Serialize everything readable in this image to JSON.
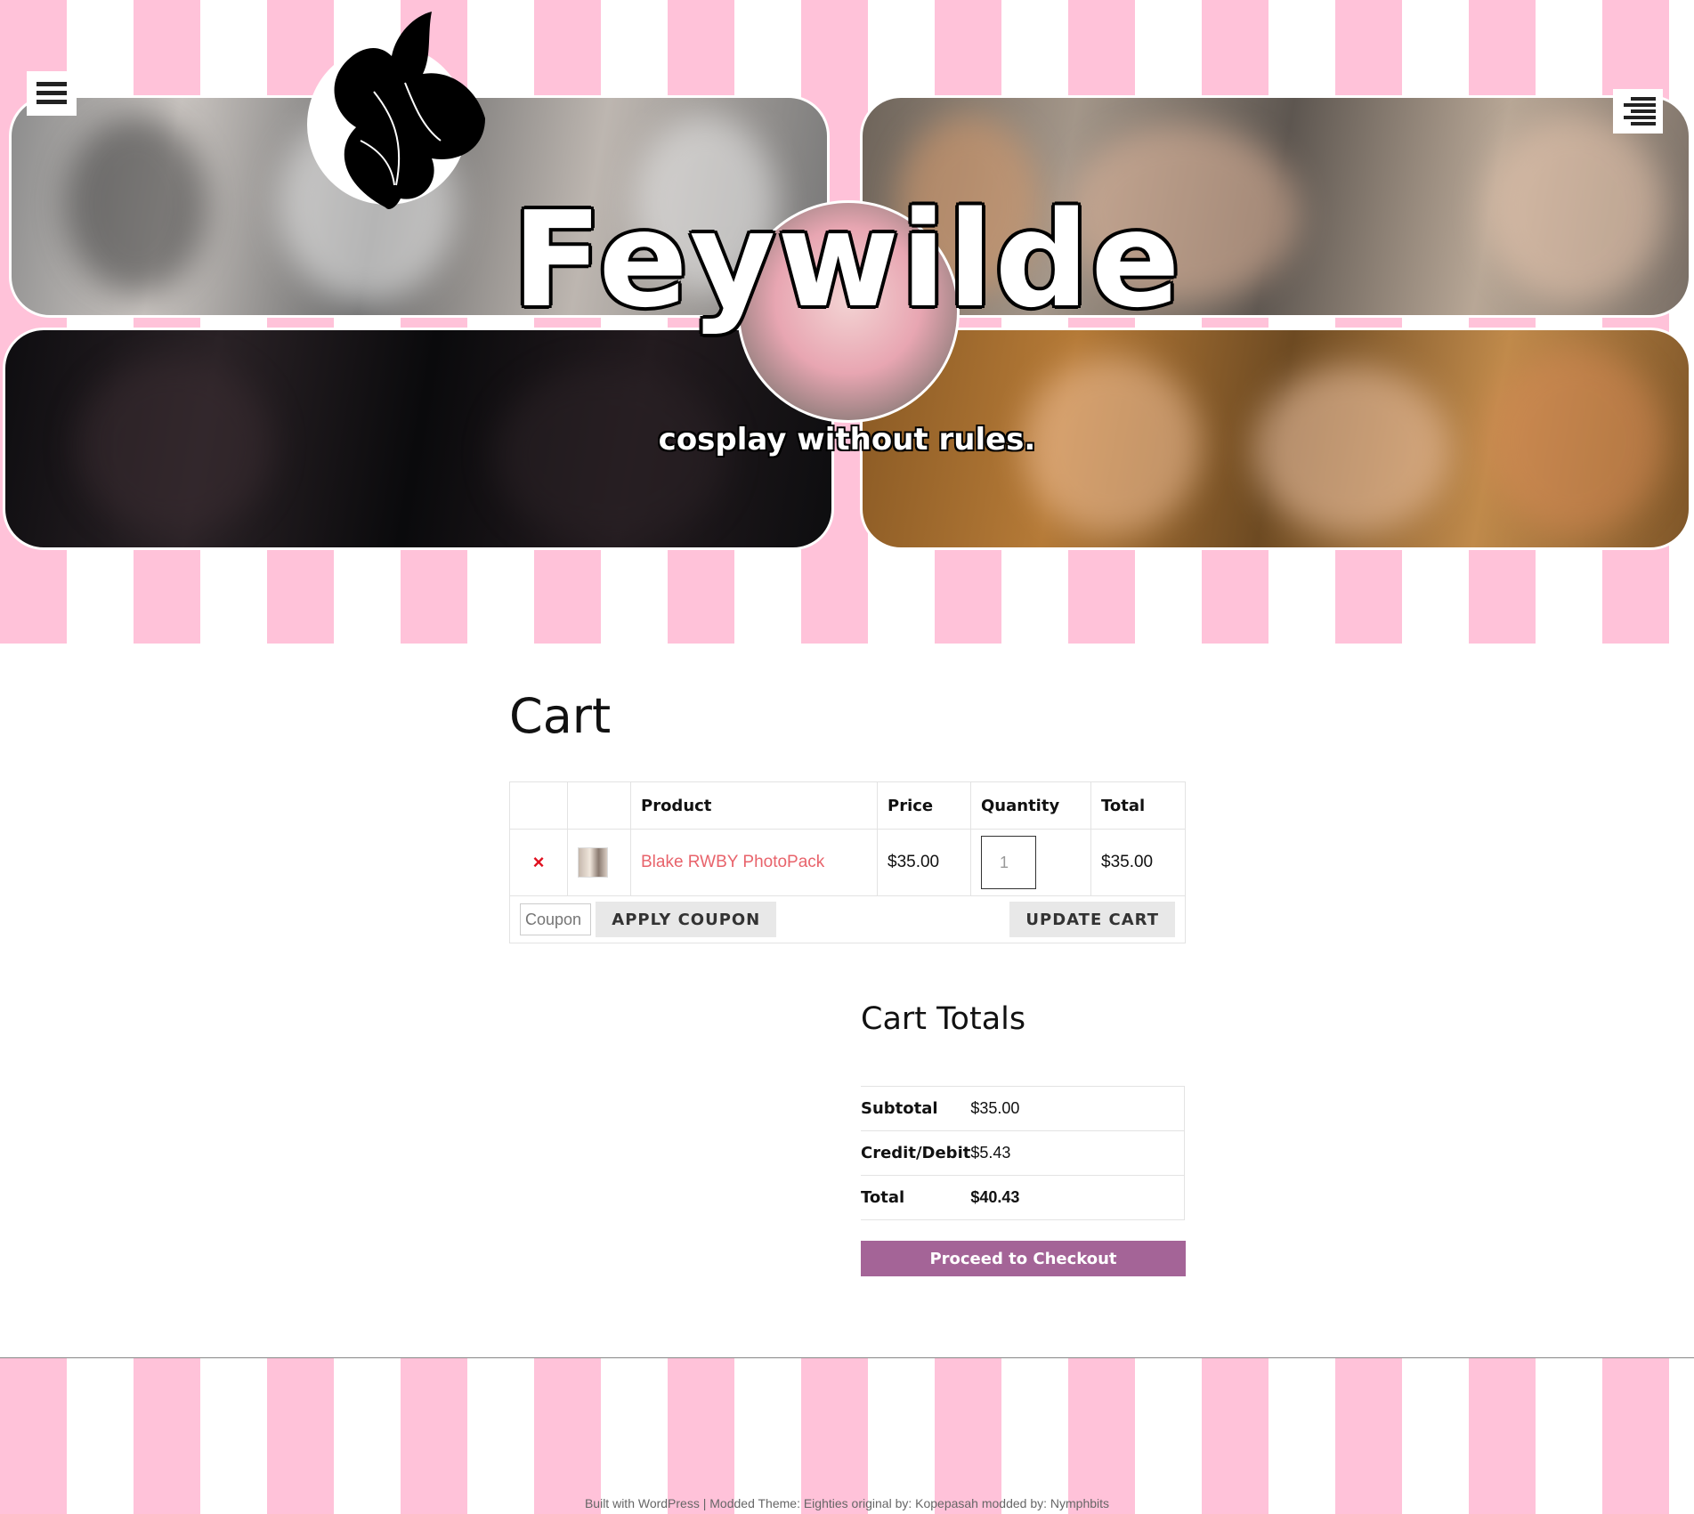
{
  "header": {
    "site_title": "Feywilde",
    "tagline": "cosplay without rules."
  },
  "icons": {
    "left_menu": "hamburger-menu-icon",
    "right_menu": "right-aligned-menu-icon",
    "logo": "butterfly-icon",
    "remove": "close-icon"
  },
  "page": {
    "title": "Cart"
  },
  "cart": {
    "headers": {
      "remove": "",
      "thumbnail": "",
      "product": "Product",
      "price": "Price",
      "quantity": "Quantity",
      "total": "Total"
    },
    "items": [
      {
        "remove_symbol": "×",
        "product": "Blake RWBY PhotoPack",
        "price": "$35.00",
        "quantity": "1",
        "total": "$35.00"
      }
    ],
    "coupon_placeholder": "Coupon",
    "apply_coupon_label": "APPLY COUPON",
    "update_cart_label": "UPDATE CART"
  },
  "totals": {
    "title": "Cart Totals",
    "rows": [
      {
        "label": "Subtotal",
        "value": "$35.00"
      },
      {
        "label": "Credit/Debit",
        "value": "$5.43"
      },
      {
        "label": "Total",
        "value": "$40.43"
      }
    ],
    "checkout_label": "Proceed to Checkout"
  },
  "footer": {
    "text": "Built with WordPress | Modded Theme: Eighties original by: Kopepasah modded by: Nymphbits"
  },
  "colors": {
    "stripe_pink": "#ffc2d9",
    "link": "#e8636b",
    "remove": "#e0101f",
    "checkout_button": "#a46497",
    "secondary_button": "#e8e8e8"
  }
}
